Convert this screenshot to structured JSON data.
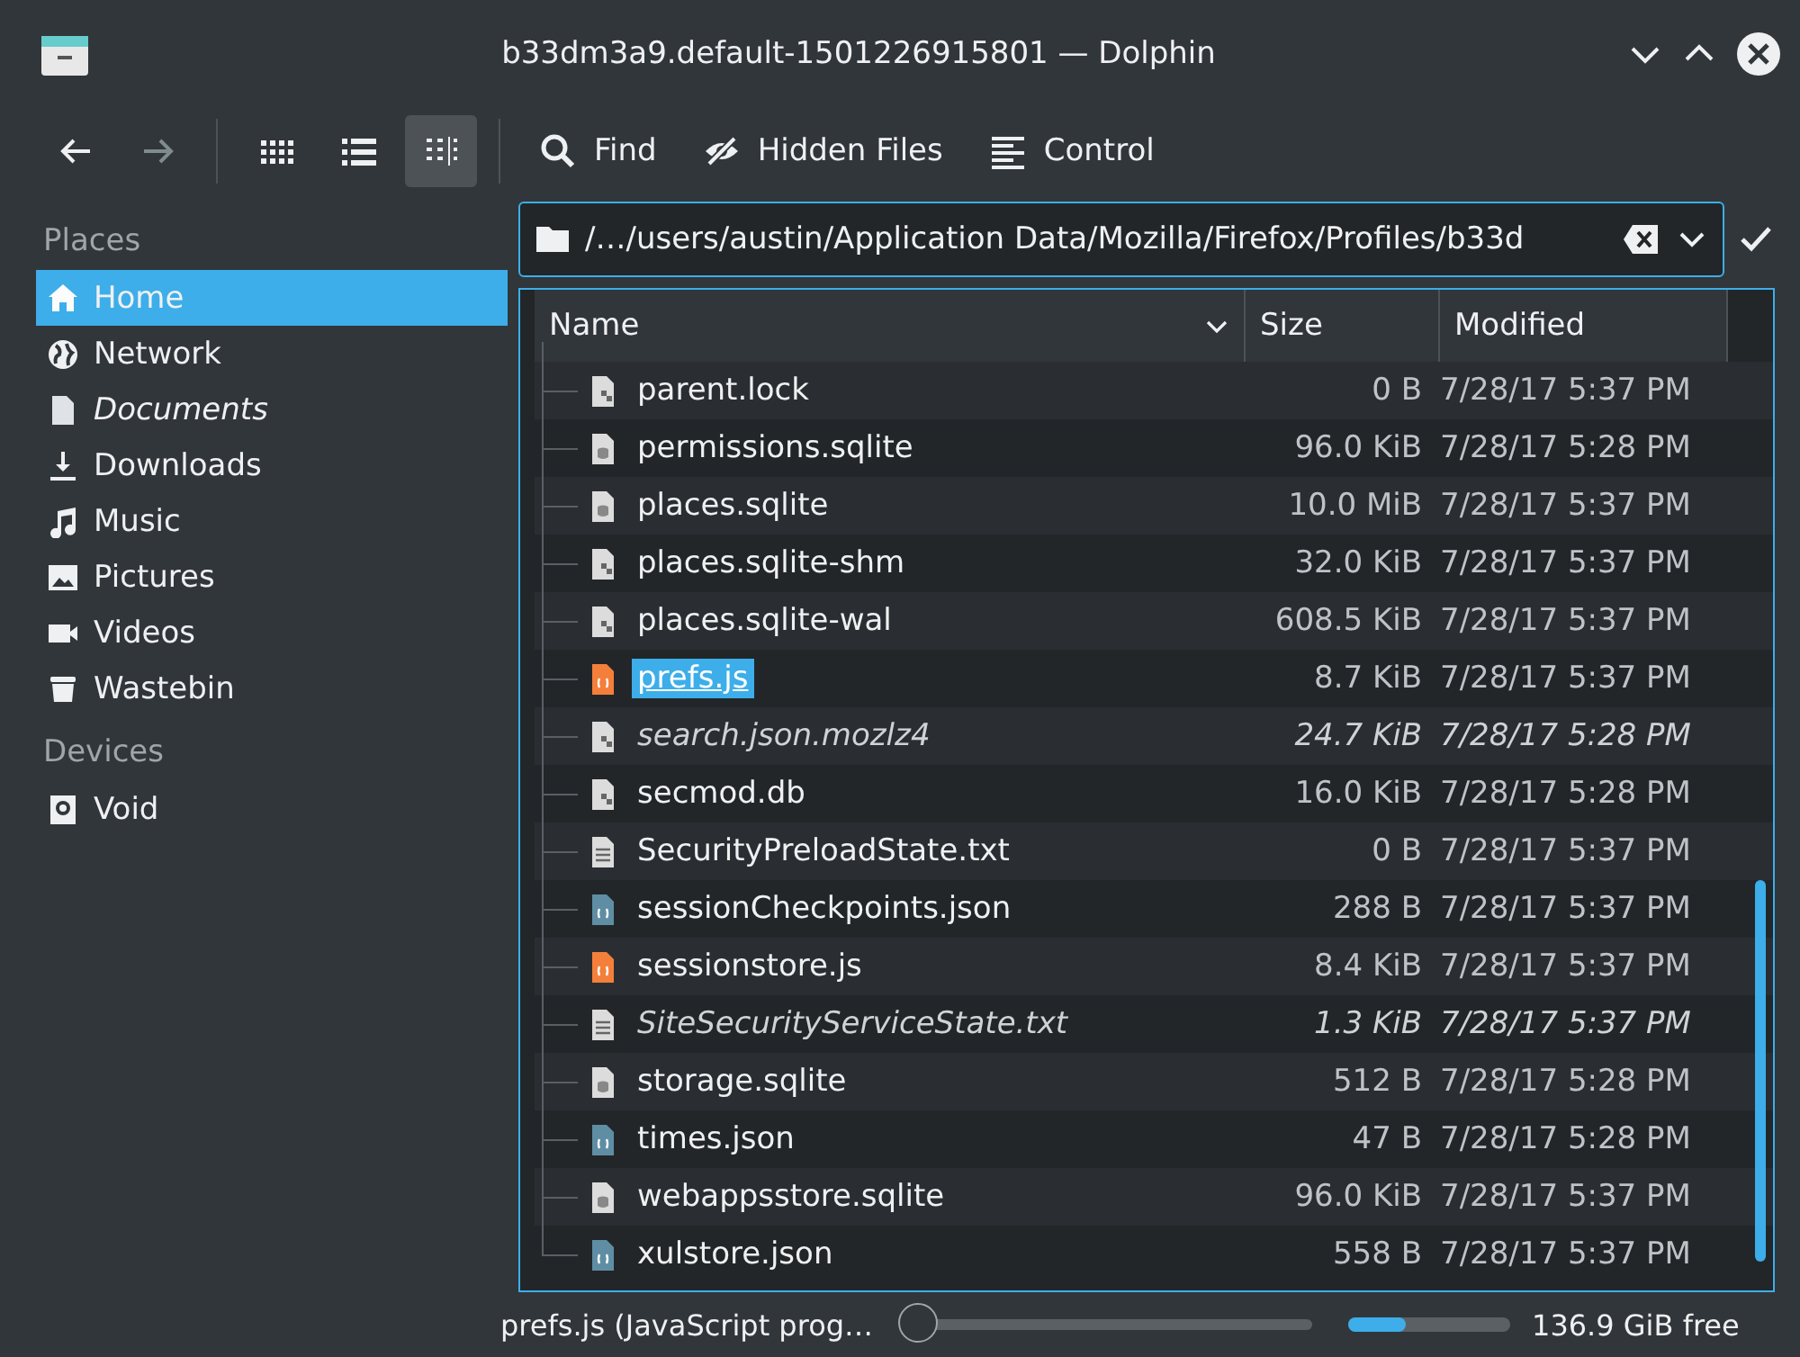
{
  "window": {
    "title": "b33dm3a9.default-1501226915801 — Dolphin"
  },
  "navigation": [
    {
      "kind": "back",
      "disabled": false
    },
    {
      "kind": "forward",
      "disabled": true
    }
  ],
  "view_modes": [
    {
      "kind": "icons",
      "selected": false
    },
    {
      "kind": "compact",
      "selected": false
    },
    {
      "kind": "details",
      "selected": true
    }
  ],
  "actions": [
    {
      "kind": "find",
      "label": "Find"
    },
    {
      "kind": "hidden",
      "label": "Hidden Files"
    },
    {
      "kind": "control",
      "label": "Control"
    }
  ],
  "places": [
    {
      "title": "Places",
      "items": [
        {
          "label": "Home",
          "kind": "home",
          "selected": true,
          "italic": false
        },
        {
          "label": "Network",
          "kind": "globe",
          "selected": false,
          "italic": false
        },
        {
          "label": "Documents",
          "kind": "document",
          "selected": false,
          "italic": true
        },
        {
          "label": "Downloads",
          "kind": "download",
          "selected": false,
          "italic": false
        },
        {
          "label": "Music",
          "kind": "music",
          "selected": false,
          "italic": false
        },
        {
          "label": "Pictures",
          "kind": "picture",
          "selected": false,
          "italic": false
        },
        {
          "label": "Videos",
          "kind": "video",
          "selected": false,
          "italic": false
        },
        {
          "label": "Wastebin",
          "kind": "trash",
          "selected": false,
          "italic": false
        }
      ]
    },
    {
      "title": "Devices",
      "items": [
        {
          "label": "Void",
          "kind": "drive",
          "selected": false,
          "italic": false
        }
      ]
    }
  ],
  "location": {
    "path": "/…/users/austin/Application Data/Mozilla/Firefox/Profiles/b33d"
  },
  "columns": [
    "Name",
    "Size",
    "Modified"
  ],
  "rows": [
    {
      "name": "parent.lock",
      "size": "0 B",
      "modified": "7/28/17 5:37 PM",
      "kind": "binary",
      "selected": false,
      "italic": false
    },
    {
      "name": "permissions.sqlite",
      "size": "96.0 KiB",
      "modified": "7/28/17 5:28 PM",
      "kind": "database",
      "selected": false,
      "italic": false
    },
    {
      "name": "places.sqlite",
      "size": "10.0 MiB",
      "modified": "7/28/17 5:37 PM",
      "kind": "database",
      "selected": false,
      "italic": false
    },
    {
      "name": "places.sqlite-shm",
      "size": "32.0 KiB",
      "modified": "7/28/17 5:37 PM",
      "kind": "binary",
      "selected": false,
      "italic": false
    },
    {
      "name": "places.sqlite-wal",
      "size": "608.5 KiB",
      "modified": "7/28/17 5:37 PM",
      "kind": "binary",
      "selected": false,
      "italic": false
    },
    {
      "name": "prefs.js",
      "size": "8.7 KiB",
      "modified": "7/28/17 5:37 PM",
      "kind": "script",
      "selected": true,
      "italic": false
    },
    {
      "name": "search.json.mozlz4",
      "size": "24.7 KiB",
      "modified": "7/28/17 5:28 PM",
      "kind": "binary",
      "selected": false,
      "italic": true
    },
    {
      "name": "secmod.db",
      "size": "16.0 KiB",
      "modified": "7/28/17 5:28 PM",
      "kind": "binary",
      "selected": false,
      "italic": false
    },
    {
      "name": "SecurityPreloadState.txt",
      "size": "0 B",
      "modified": "7/28/17 5:37 PM",
      "kind": "text",
      "selected": false,
      "italic": false
    },
    {
      "name": "sessionCheckpoints.json",
      "size": "288 B",
      "modified": "7/28/17 5:37 PM",
      "kind": "json",
      "selected": false,
      "italic": false
    },
    {
      "name": "sessionstore.js",
      "size": "8.4 KiB",
      "modified": "7/28/17 5:37 PM",
      "kind": "script",
      "selected": false,
      "italic": false
    },
    {
      "name": "SiteSecurityServiceState.txt",
      "size": "1.3 KiB",
      "modified": "7/28/17 5:37 PM",
      "kind": "text",
      "selected": false,
      "italic": true
    },
    {
      "name": "storage.sqlite",
      "size": "512 B",
      "modified": "7/28/17 5:28 PM",
      "kind": "database",
      "selected": false,
      "italic": false
    },
    {
      "name": "times.json",
      "size": "47 B",
      "modified": "7/28/17 5:28 PM",
      "kind": "json",
      "selected": false,
      "italic": false
    },
    {
      "name": "webappsstore.sqlite",
      "size": "96.0 KiB",
      "modified": "7/28/17 5:37 PM",
      "kind": "database",
      "selected": false,
      "italic": false
    },
    {
      "name": "xulstore.json",
      "size": "558 B",
      "modified": "7/28/17 5:37 PM",
      "kind": "json",
      "selected": false,
      "italic": false
    }
  ],
  "status_bar": {
    "text": "prefs.js (JavaScript prog…",
    "zoom": {
      "level": 0
    },
    "disk": {
      "level": 0.35
    },
    "free": "136.9 GiB free"
  }
}
